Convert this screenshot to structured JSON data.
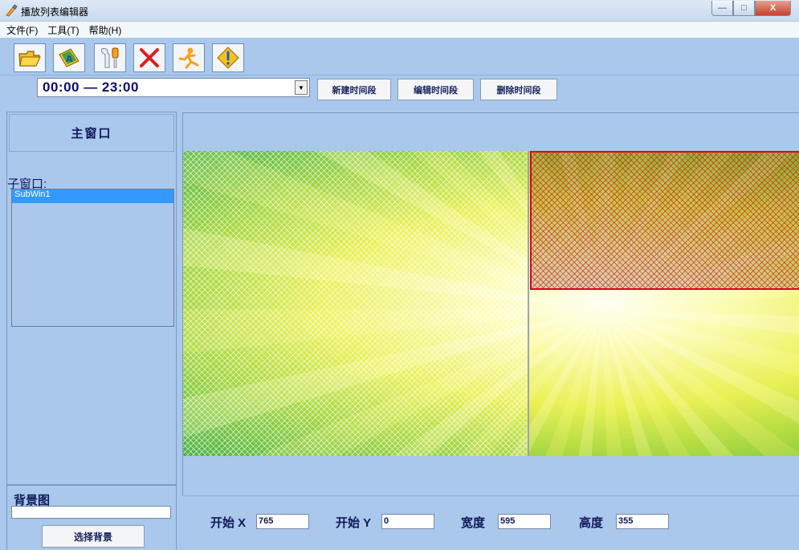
{
  "window": {
    "title": "播放列表编辑器",
    "minimize_glyph": "—",
    "maximize_glyph": "□",
    "close_glyph": "X"
  },
  "menu": [
    "文件(F)",
    "工具(T)",
    "帮助(H)"
  ],
  "toolbar": {
    "icons": [
      "open-folder-icon",
      "image-text-icon",
      "tools-icon",
      "delete-x-icon",
      "run-icon",
      "info-diamond-icon"
    ]
  },
  "time_segment": {
    "selected": "00:00 — 23:00",
    "new_label": "新建时间段",
    "edit_label": "编辑时间段",
    "delete_label": "删除时间段"
  },
  "windows": {
    "main_window_label": "主窗口",
    "sub_window_label": "子窗口:",
    "sub_windows": [
      "SubWin1"
    ]
  },
  "background": {
    "label": "背景图",
    "path_value": "",
    "choose_label": "选择背景"
  },
  "coords": {
    "start_x_label": "开始 X",
    "start_x": "765",
    "start_y_label": "开始 Y",
    "start_y": "0",
    "width_label": "宽度",
    "width": "595",
    "height_label": "高度",
    "height": "355"
  },
  "colors": {
    "app_background": "#a9c8ec",
    "selection": "#3399ff",
    "sub_window_border": "#e0001a"
  }
}
